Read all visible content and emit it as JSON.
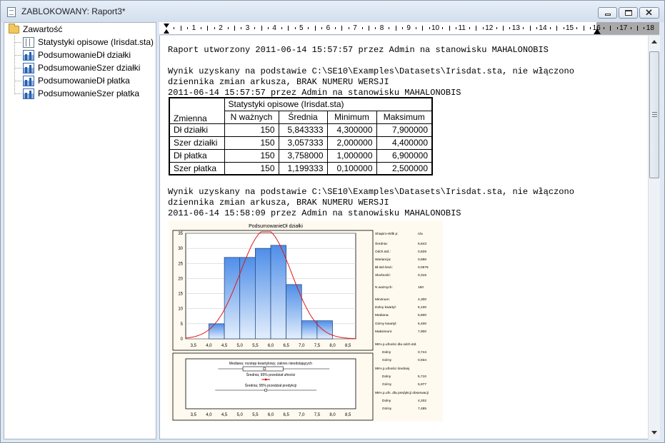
{
  "window": {
    "title": "ZABLOKOWANY: Raport3*"
  },
  "tree": {
    "root_label": "Zawartość",
    "items": [
      {
        "label": "Statystyki opisowe (Irisdat.sta)",
        "icon": "table-icon"
      },
      {
        "label": "PodsumowanieDł działki",
        "icon": "graph-icon"
      },
      {
        "label": "PodsumowanieSzer działki",
        "icon": "graph-icon"
      },
      {
        "label": "PodsumowanieDł płatka",
        "icon": "graph-icon"
      },
      {
        "label": "PodsumowanieSzer płatka",
        "icon": "graph-icon"
      }
    ]
  },
  "ruler": {
    "labels": [
      "1",
      "2",
      "3",
      "4",
      "5",
      "6",
      "7",
      "8",
      "9",
      "10",
      "11",
      "12",
      "13",
      "14",
      "15",
      "16",
      "17",
      "18"
    ]
  },
  "report": {
    "line1": "Raport utworzony 2011-06-14 15:57:57 przez Admin na stanowisku MAHALONOBIS",
    "block1": [
      "Wynik uzyskany na podstawie C:\\SE10\\Examples\\Datasets\\Irisdat.sta, nie włączono",
      "dziennika zmian arkusza, BRAK NUMERU WERSJI",
      "2011-06-14 15:57:57 przez Admin na stanowisku MAHALONOBIS"
    ],
    "block2": [
      "Wynik uzyskany na podstawie C:\\SE10\\Examples\\Datasets\\Irisdat.sta, nie włączono",
      "dziennika zmian arkusza, BRAK NUMERU WERSJI",
      "2011-06-14 15:58:09 przez Admin na stanowisku MAHALONOBIS"
    ]
  },
  "table": {
    "caption": "Statystyki opisowe (Irisdat.sta)",
    "row_header": "Zmienna",
    "columns": [
      "N ważnych",
      "Średnia",
      "Minimum",
      "Maksimum"
    ],
    "rows": [
      {
        "name": "Dł działki",
        "values": [
          "150",
          "5,843333",
          "4,300000",
          "7,900000"
        ]
      },
      {
        "name": "Szer działki",
        "values": [
          "150",
          "3,057333",
          "2,000000",
          "4,400000"
        ]
      },
      {
        "name": "Dł płatka",
        "values": [
          "150",
          "3,758000",
          "1,000000",
          "6,900000"
        ]
      },
      {
        "name": "Szer płatka",
        "values": [
          "150",
          "1,199333",
          "0,100000",
          "2,500000"
        ]
      }
    ]
  },
  "chart_data": {
    "type": "bar",
    "title": "PodsumowanieDł działki",
    "bin_edges": [
      4.0,
      4.5,
      5.0,
      5.5,
      6.0,
      6.5,
      7.0,
      7.5,
      8.0
    ],
    "values": [
      5,
      27,
      27,
      30,
      31,
      18,
      6,
      6
    ],
    "ylim": [
      0,
      35
    ],
    "yticks": [
      0,
      5,
      10,
      15,
      20,
      25,
      30,
      35
    ],
    "xlim": [
      3.25,
      8.75
    ],
    "xticks": [
      "3,5",
      "4,0",
      "4,5",
      "5,0",
      "5,5",
      "6,0",
      "6,5",
      "7,0",
      "7,5",
      "8,0",
      "8,5"
    ],
    "normal_curve": {
      "mean": 5.843,
      "sd": 0.828
    },
    "bar_color": "#4f8ee8",
    "curve_color": "#e01818",
    "box_labels": [
      "Mediana; rozstęp kwartylowy; zakres nieodstających",
      "Średnia; 95% przedział ufności",
      "Średnia; 95% przedział predykcji"
    ],
    "stats": [
      {
        "label": "Shapiro-Wilk p:",
        "value": "n/a"
      },
      {
        "label": "Średnia:",
        "value": "5,843"
      },
      {
        "label": "Odch.std.:",
        "value": "0,828"
      },
      {
        "label": "Wariancja:",
        "value": "0,686"
      },
      {
        "label": "Bł.std.śred.:",
        "value": "0,0676"
      },
      {
        "label": "Skośność:",
        "value": "0,315"
      },
      {
        "label": "N ważnych:",
        "value": "150"
      },
      {
        "label": "Minimum:",
        "value": "4,300"
      },
      {
        "label": "Dolny kwartyl:",
        "value": "5,100"
      },
      {
        "label": "Mediana:",
        "value": "5,800"
      },
      {
        "label": "Górny kwartyl:",
        "value": "6,400"
      },
      {
        "label": "Maksimum:",
        "value": "7,900"
      }
    ],
    "intervals": [
      {
        "title": "95% p.ufności dla odch.std.",
        "low_label": "Dolny",
        "low": "0,744",
        "high_label": "Górny",
        "high": "0,934"
      },
      {
        "title": "95% p.ufności średniej",
        "low_label": "Dolny",
        "low": "5,710",
        "high_label": "Górny",
        "high": "5,977"
      },
      {
        "title": "95% p.ufn. dla predykcji obserwacji",
        "low_label": "Dolny",
        "low": "4,202",
        "high_label": "Górny",
        "high": "7,485"
      }
    ]
  }
}
